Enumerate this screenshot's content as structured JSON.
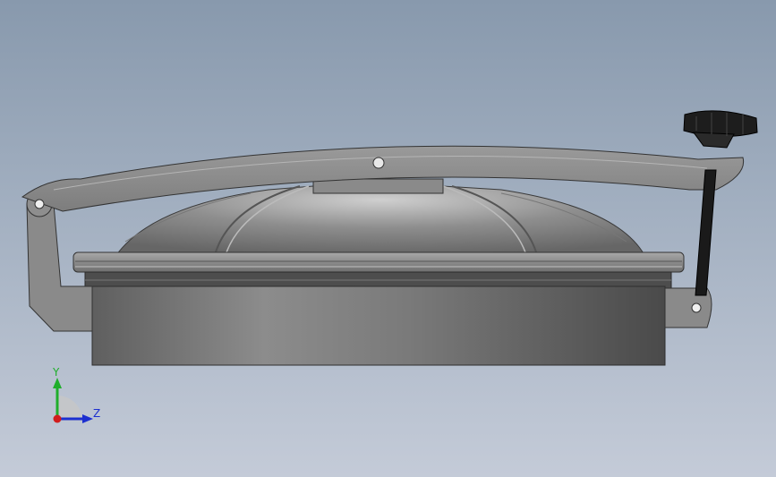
{
  "viewport": {
    "background_top": "#8899ad",
    "background_bottom": "#c4cbd8",
    "model": "manhole-cover-assembly"
  },
  "triad": {
    "y_label": "Y",
    "z_label": "Z",
    "y_color": "#1fae2b",
    "z_color": "#1c2fd0",
    "x_color": "#d11d1d"
  }
}
